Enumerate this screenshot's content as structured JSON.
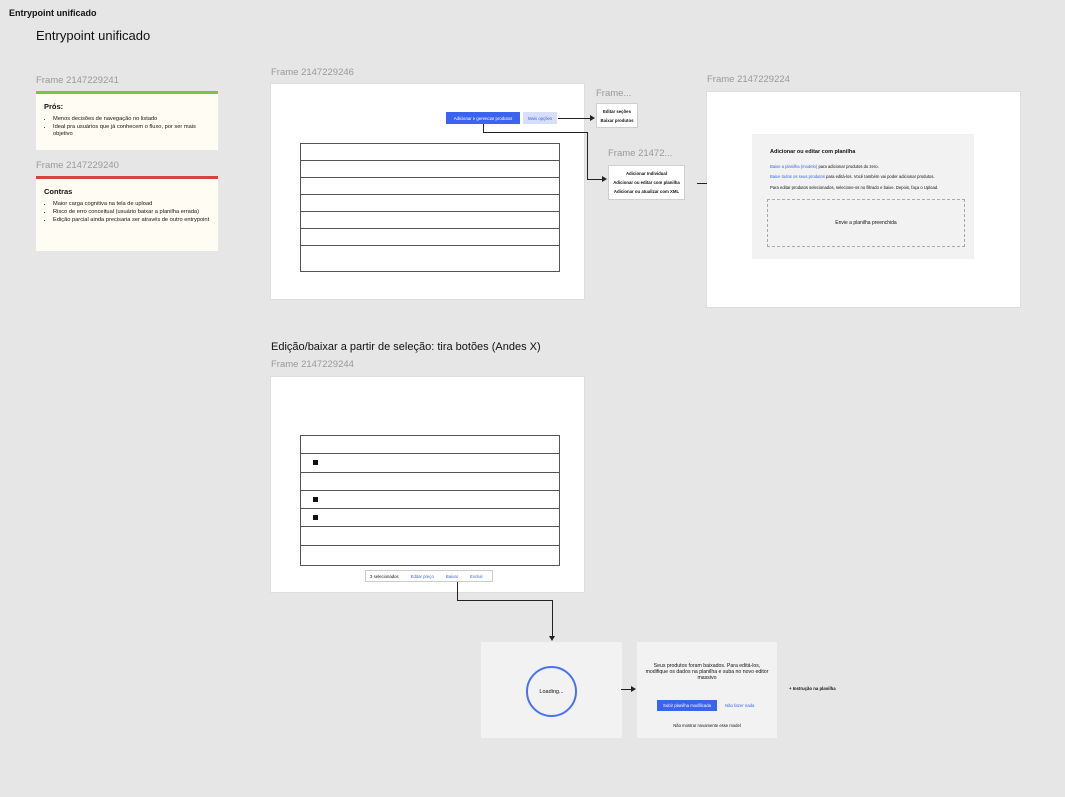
{
  "page": {
    "label": "Entrypoint unificado"
  },
  "section1": {
    "title": "Entrypoint unificado"
  },
  "notes": {
    "pros": {
      "frame_label": "Frame 2147229241",
      "title": "Prós:",
      "items": [
        "Menos decisões de navegação no listado",
        "Ideal pra usuários que já conhecem o fluxo, por ser mais objetivo"
      ]
    },
    "cons": {
      "frame_label": "Frame 2147229240",
      "title": "Contras",
      "items": [
        "Maior carga cognitiva na tela de upload",
        "Risco de erro conceitual (usuário baixar a planilha errada)",
        "Edição parcial ainda precisaria ser através de outro entrypoint"
      ]
    }
  },
  "frame246": {
    "label": "Frame 2147229246",
    "primary_button": "Adicionar e gerenciar produtos",
    "secondary_button": "Mais opções"
  },
  "menu_more": {
    "label": "Frame...",
    "items": [
      "Editar seções",
      "Baixar produtos"
    ]
  },
  "menu_add": {
    "label": "Frame 21472...",
    "items": [
      "Adicionar Individual",
      "Adicionar ou editar com planilha",
      "Adicionar ou atualizar com XML"
    ]
  },
  "frame224": {
    "label": "Frame 2147229224",
    "title": "Adicionar ou editar com planilha",
    "line1_link": "Baixe a planilha (modelo)",
    "line1_text": "para adicionar produtos do zero.",
    "line2_link": "Baixe todos os seus produtos",
    "line2_text": "para editá-los. Você também vai poder adicionar produtos.",
    "line3": "Para editar produtos selecionados, selecione-os no filtrado e baixe. Depois, faça o Upload.",
    "dropzone": "Envie a planilha preenchida"
  },
  "section2": {
    "title": "Edição/baixar a partir de seleção: tira botões (Andes X)"
  },
  "frame244": {
    "label": "Frame 2147229244",
    "rows_checked": [
      false,
      true,
      false,
      true,
      true,
      false,
      false
    ],
    "bar": {
      "count": "3 selecionados",
      "edit_price": "Editar preço",
      "download": "Baixar",
      "delete": "Excluir"
    }
  },
  "loading": {
    "text": "Loading..."
  },
  "result": {
    "message": "Seus produtos foram baixados. Para editá-los, modifique os dados na planilha e suba no novo editor massivo",
    "primary": "Subir planilha modificada",
    "secondary": "Não fazer nada",
    "dont_show": "Não mostrar novamente esse model"
  },
  "annotation": {
    "text": "+ Instrução na planilha"
  },
  "colors": {
    "accent": "#3b63ee",
    "pros": "#7bc44a",
    "cons": "#d6453d"
  }
}
